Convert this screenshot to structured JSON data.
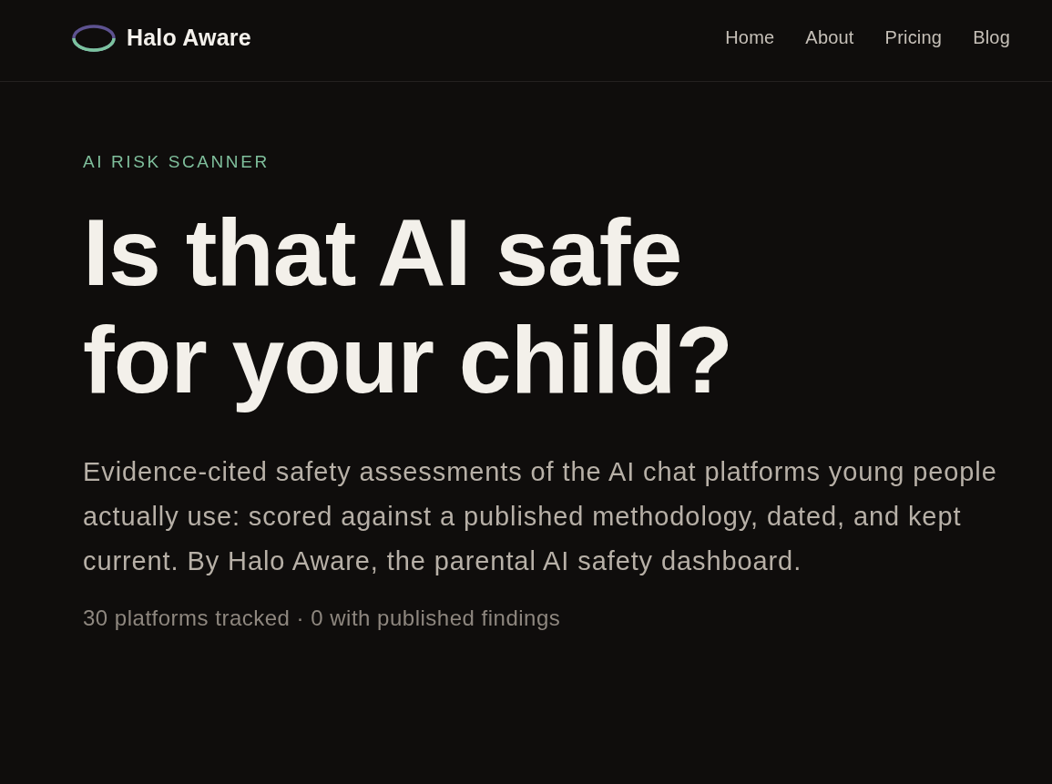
{
  "header": {
    "brand": "Halo Aware",
    "nav": [
      {
        "label": "Home"
      },
      {
        "label": "About"
      },
      {
        "label": "Pricing"
      },
      {
        "label": "Blog"
      }
    ]
  },
  "hero": {
    "eyebrow": "AI RISK SCANNER",
    "headline": "Is that AI safe for your child?",
    "description": "Evidence-cited safety assessments of the AI chat platforms young people actually use: scored against a published methodology, dated, and kept current. By Halo Aware, the parental AI safety dashboard.",
    "stats": "30 platforms tracked · 0 with published findings"
  }
}
